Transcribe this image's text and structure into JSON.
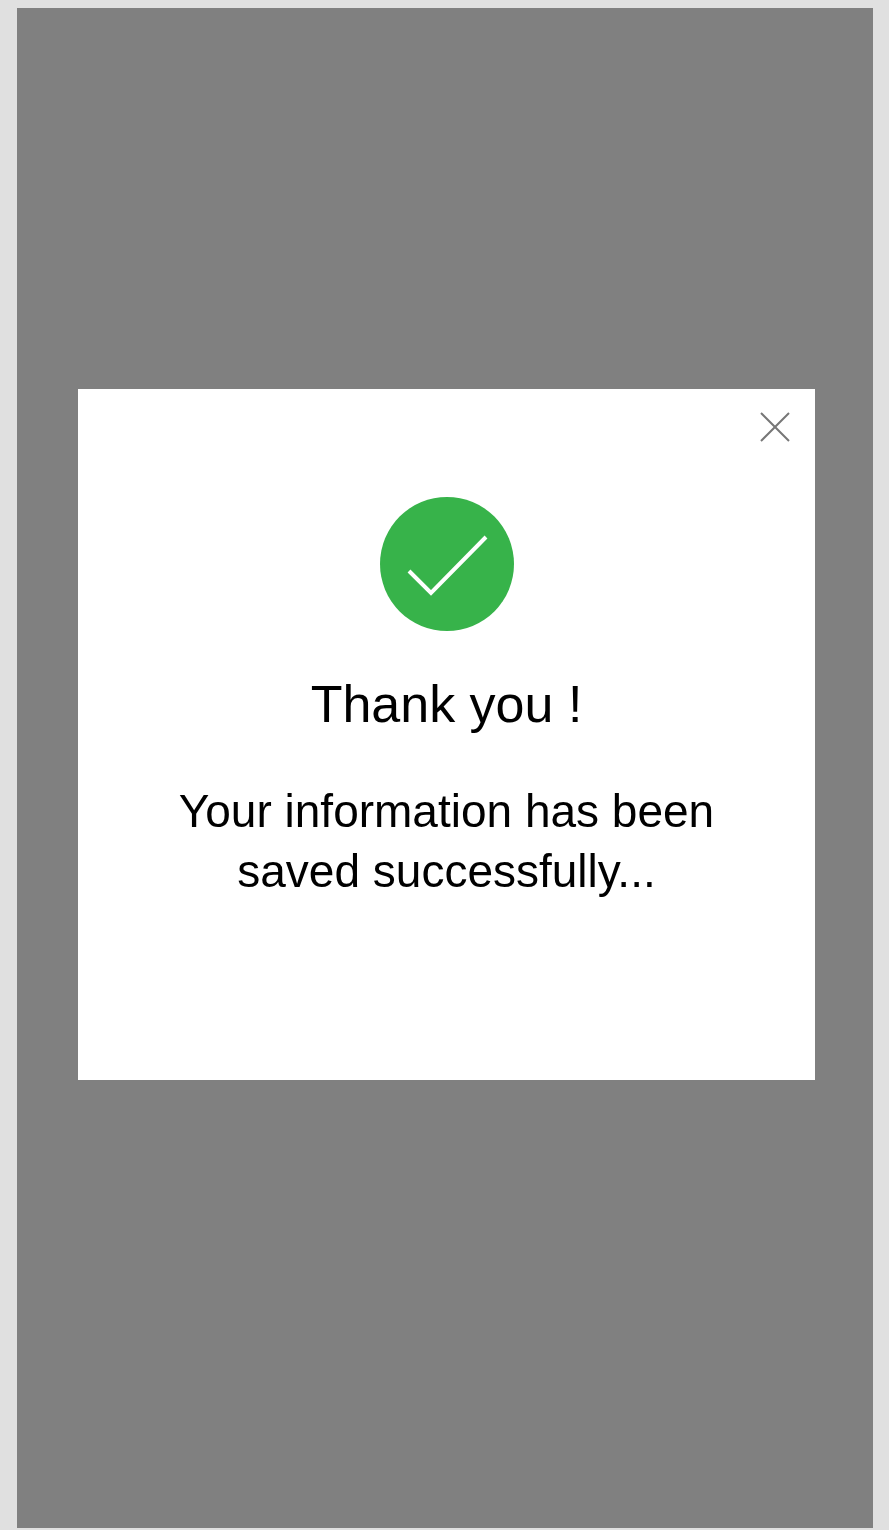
{
  "dialog": {
    "title": "Thank you !",
    "message": "Your information has been saved successfully..."
  }
}
